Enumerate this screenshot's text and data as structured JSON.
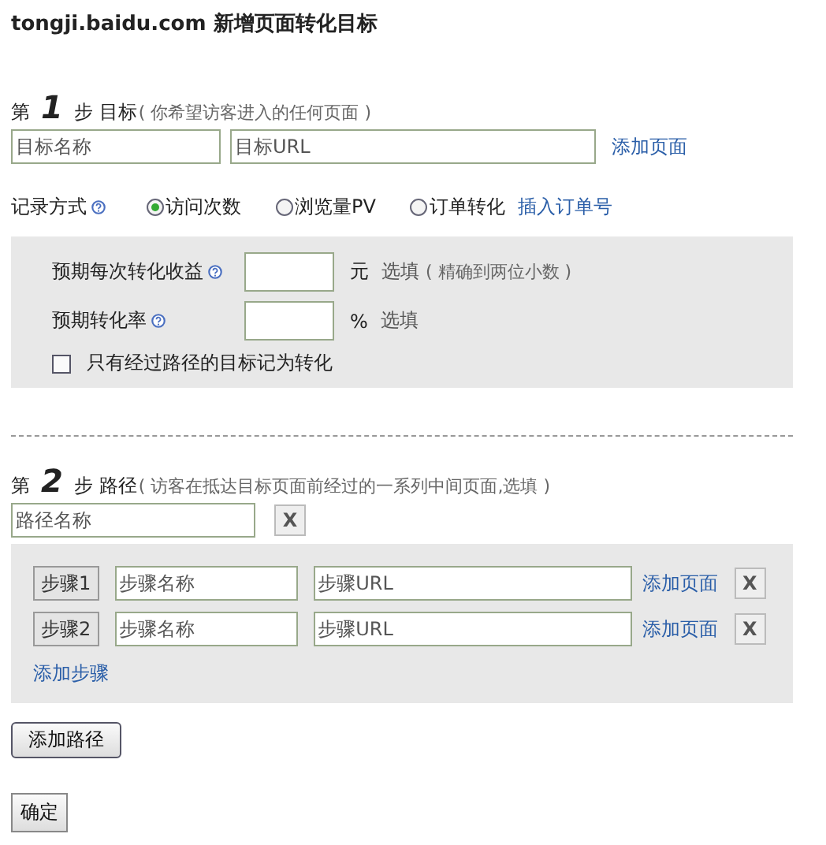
{
  "page_title": "tongji.baidu.com 新增页面转化目标",
  "step1": {
    "prefix": "第",
    "number": "1",
    "suffix": "步",
    "title": "目标",
    "note": "( 你希望访客进入的任何页面 )",
    "name_field": {
      "placeholder": "目标名称"
    },
    "url_field": {
      "placeholder": "目标URL"
    },
    "add_link": "添加页面"
  },
  "record_mode": {
    "label": "记录方式",
    "options": [
      {
        "label": "访问次数",
        "selected": true
      },
      {
        "label": "浏览量PV",
        "selected": false
      },
      {
        "label": "订单转化",
        "selected": false,
        "link": "插入订单号"
      }
    ]
  },
  "options_panel": {
    "fields": [
      {
        "label": "预期每次转化收益",
        "unit": "元",
        "hint": "选填",
        "note": "( 精确到两位小数 )"
      },
      {
        "label": "预期转化率",
        "unit": "%",
        "hint": "选填"
      }
    ],
    "checkbox": {
      "label": "只有经过路径的目标记为转化",
      "checked": false
    }
  },
  "step2": {
    "prefix": "第",
    "number": "2",
    "suffix": "步",
    "title": "路径",
    "note": "( 访客在抵达目标页面前经过的一系列中间页面,选填 )",
    "path_field": {
      "placeholder": "路径名称"
    },
    "remove_button": "X",
    "steps": [
      {
        "button": "步骤1",
        "name_placeholder": "步骤名称",
        "url_placeholder": "步骤URL",
        "add_link": "添加页面",
        "remove_button": "X"
      },
      {
        "button": "步骤2",
        "name_placeholder": "步骤名称",
        "url_placeholder": "步骤URL",
        "add_link": "添加页面",
        "remove_button": "X"
      }
    ],
    "add_step_link": "添加步骤"
  },
  "add_path_button": "添加路径",
  "confirm_button": "确定"
}
